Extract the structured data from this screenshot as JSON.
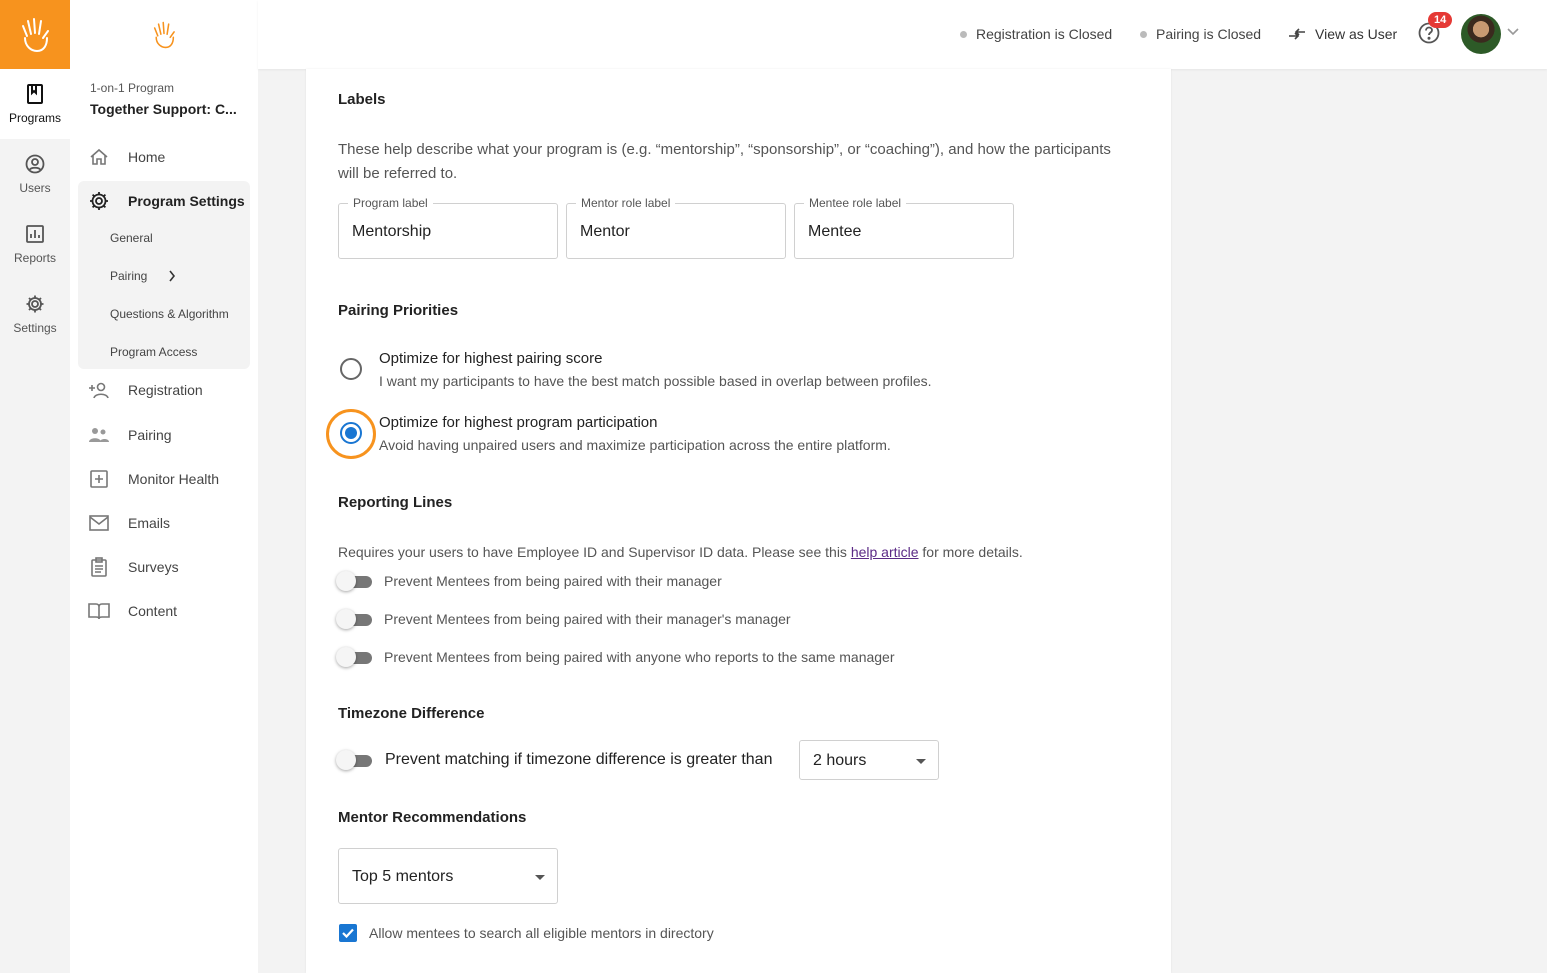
{
  "rail": {
    "items": [
      {
        "label": "Programs",
        "icon": "book-icon",
        "active": true
      },
      {
        "label": "Users",
        "icon": "user-circle-icon"
      },
      {
        "label": "Reports",
        "icon": "bar-chart-icon"
      },
      {
        "label": "Settings",
        "icon": "gear-icon"
      }
    ]
  },
  "sidebar": {
    "program_type": "1-on-1 Program",
    "program_name": "Together Support: C...",
    "home": "Home",
    "program_settings": "Program Settings",
    "sub_items": [
      "General",
      "Pairing",
      "Questions & Algorithm",
      "Program Access"
    ],
    "registration": "Registration",
    "pairing": "Pairing",
    "monitor_health": "Monitor Health",
    "emails": "Emails",
    "surveys": "Surveys",
    "content": "Content"
  },
  "topbar": {
    "registration_status": "Registration is Closed",
    "pairing_status": "Pairing is Closed",
    "view_as_user": "View as User",
    "notification_count": "14"
  },
  "labels": {
    "heading": "Labels",
    "description": "These help describe what your program is (e.g. “mentorship”, “sponsorship”, or “coaching”), and how the participants will be referred to.",
    "program_label": {
      "label": "Program label",
      "value": "Mentorship"
    },
    "mentor_label": {
      "label": "Mentor role label",
      "value": "Mentor"
    },
    "mentee_label": {
      "label": "Mentee role label",
      "value": "Mentee"
    }
  },
  "pairing_priorities": {
    "heading": "Pairing Priorities",
    "options": [
      {
        "title": "Optimize for highest pairing score",
        "subtitle": "I want my participants to have the best match possible based in overlap between profiles.",
        "selected": false
      },
      {
        "title": "Optimize for highest program participation",
        "subtitle": "Avoid having unpaired users and maximize participation across the entire platform.",
        "selected": true
      }
    ]
  },
  "reporting_lines": {
    "heading": "Reporting Lines",
    "desc_prefix": "Requires your users to have Employee ID and Supervisor ID data. Please see this ",
    "link_text": "help article",
    "desc_suffix": " for more details.",
    "toggles": [
      "Prevent Mentees from being paired with their manager",
      "Prevent Mentees from being paired with their manager's manager",
      "Prevent Mentees from being paired with anyone who reports to the same manager"
    ]
  },
  "timezone": {
    "heading": "Timezone Difference",
    "toggle_label": "Prevent matching if timezone difference is greater than",
    "selected": "2 hours"
  },
  "recommendations": {
    "heading": "Mentor Recommendations",
    "selected": "Top 5 mentors",
    "checkbox_label": "Allow mentees to search all eligible mentors in directory",
    "checked": true
  },
  "colors": {
    "brand": "#f7931e",
    "primary": "#1976d2",
    "badge": "#e53935"
  }
}
